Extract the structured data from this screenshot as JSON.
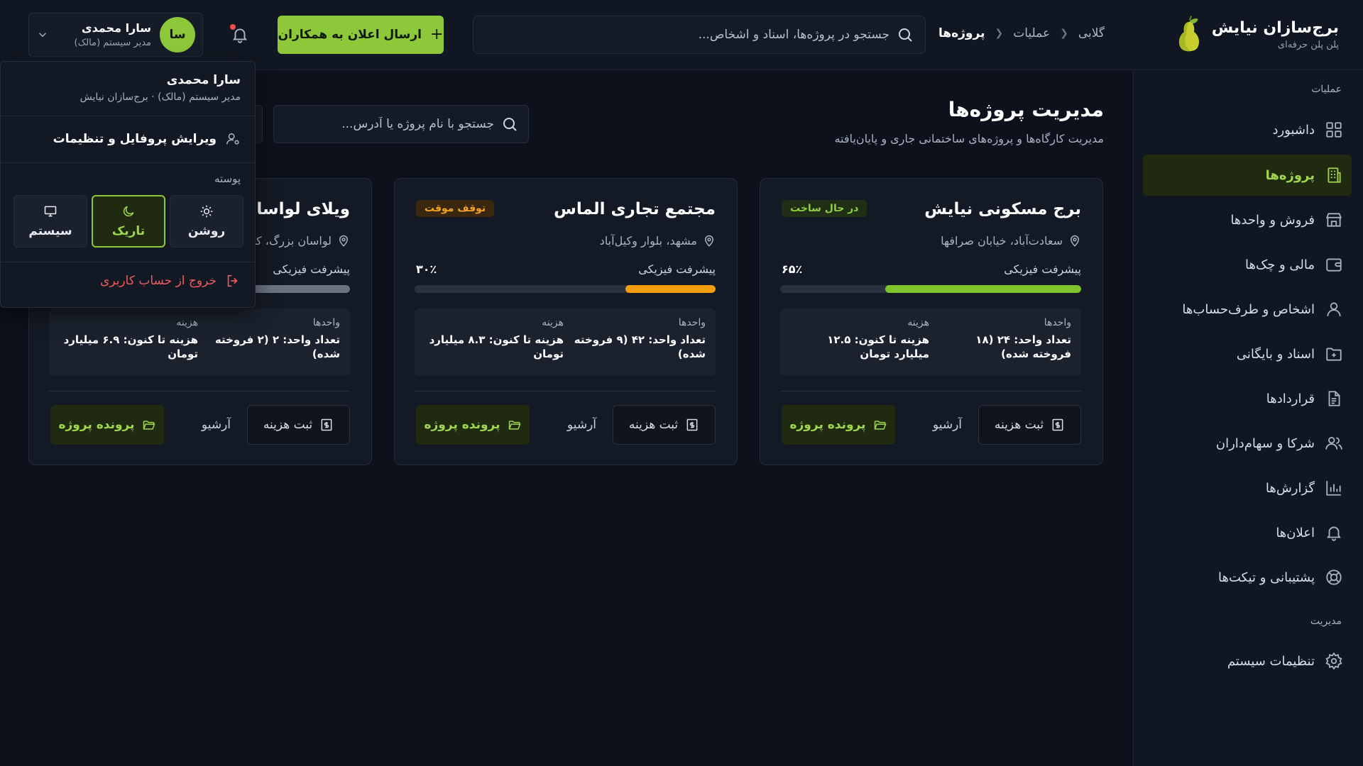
{
  "brand": {
    "title": "برج‌سازان نیایش",
    "subtitle": "پلن پلن حرفه‌ای"
  },
  "breadcrumb": [
    "گلابی",
    "عملیات",
    "پروژه‌ها"
  ],
  "search": {
    "placeholder": "جستجو در پروژه‌ها، اسناد و اشخاص..."
  },
  "announce_button": "ارسال اعلان به همکاران",
  "user": {
    "initials": "سا",
    "name": "سارا محمدی",
    "role": "مدیر سیستم (مالک)"
  },
  "sidebar": {
    "section_ops": "عملیات",
    "section_admin": "مدیریت",
    "items": [
      {
        "label": "داشبورد",
        "icon": "dashboard-icon"
      },
      {
        "label": "پروژه‌ها",
        "icon": "building-icon"
      },
      {
        "label": "فروش و واحدها",
        "icon": "store-icon"
      },
      {
        "label": "مالی و چک‌ها",
        "icon": "wallet-icon"
      },
      {
        "label": "اشخاص و طرف‌حساب‌ها",
        "icon": "person-icon"
      },
      {
        "label": "اسناد و بایگانی",
        "icon": "folder-icon"
      },
      {
        "label": "قراردادها",
        "icon": "document-icon"
      },
      {
        "label": "شرکا و سهام‌داران",
        "icon": "users-icon"
      },
      {
        "label": "گزارش‌ها",
        "icon": "chart-icon"
      },
      {
        "label": "اعلان‌ها",
        "icon": "bell-icon"
      },
      {
        "label": "پشتیبانی و تیکت‌ها",
        "icon": "lifebuoy-icon"
      }
    ],
    "admin_items": [
      {
        "label": "تنظیمات سیستم",
        "icon": "gear-icon"
      }
    ]
  },
  "page": {
    "title": "مدیریت پروژه‌ها",
    "subtitle": "مدیریت کارگاه‌ها و پروژه‌های ساختمانی جاری و پایان‌یافته",
    "search_placeholder": "جستجو با نام پروژه یا آدرس..."
  },
  "labels": {
    "progress": "پیشرفت فیزیکی",
    "units": "واحدها",
    "cost": "هزینه",
    "add_cost": "ثبت هزینه",
    "archive": "آرشیو",
    "project_file": "پرونده پروژه"
  },
  "projects": [
    {
      "title": "برج مسکونی نیایش",
      "status": "در حال ساخت",
      "status_color": "#8fd043",
      "location": "سعادت‌آباد، خیابان صرافها",
      "progress_text": "۶۵٪",
      "progress": 65,
      "bar_color": "#7ec42c",
      "units": "تعداد واحد: ۲۴ (۱۸ فروخته شده)",
      "cost": "هزینه تا کنون: ۱۲.۵ میلیارد تومان"
    },
    {
      "title": "مجتمع تجاری الماس",
      "status": "توقف موقت",
      "status_color": "#f4a226",
      "location": "مشهد، بلوار وکیل‌آباد",
      "progress_text": "۳۰٪",
      "progress": 30,
      "bar_color": "#f59e0b",
      "units": "تعداد واحد: ۴۲ (۹ فروخته شده)",
      "cost": "هزینه تا کنون: ۸.۳ میلیارد تومان"
    },
    {
      "title": "ویلای لواسان",
      "status": "",
      "location": "لواسان بزرگ، کو",
      "progress_text": "",
      "progress": 100,
      "bar_color": "#6b7280",
      "units": "تعداد واحد: ۲ (۲ فروخته شده)",
      "cost": "هزینه تا کنون: ۶.۹ میلیارد تومان"
    }
  ],
  "dropdown": {
    "name": "سارا محمدی",
    "role": "مدیر سیستم (مالک) · برج‌سازان نیایش",
    "edit_profile": "ویرایش پروفایل و تنظیمات",
    "skin_label": "پوسته",
    "themes": [
      {
        "label": "روشن",
        "icon": "sun-icon",
        "active": false
      },
      {
        "label": "تاریک",
        "icon": "moon-icon",
        "active": true
      },
      {
        "label": "سیستم",
        "icon": "monitor-icon",
        "active": false
      }
    ],
    "logout": "خروج از حساب کاربری"
  },
  "colors": {
    "accent": "#8cc83a",
    "danger": "#ef5a5a",
    "warning": "#f4a226"
  }
}
